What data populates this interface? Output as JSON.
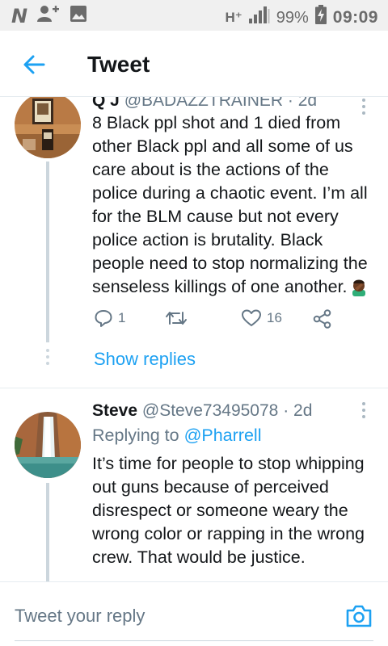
{
  "status_bar": {
    "left_letter": "N",
    "network": "H⁺",
    "battery": "99%",
    "time": "09:09"
  },
  "header": {
    "title": "Tweet"
  },
  "tweets": [
    {
      "name": "Q J",
      "handle": "@BADAZZTRAINER",
      "age": "· 2d",
      "text_lines": [
        "8 Black ppl shot and 1 died from",
        "other Black ppl and all some of us",
        "care about is the actions of the",
        "police during a chaotic event. I’m all",
        "for the BLM cause but not every",
        "police action is brutality. Black",
        "people need to stop normalizing the",
        "senseless killings of one another."
      ],
      "emoji_icon": "facepalm-emoji",
      "reply_count": "1",
      "retweet_count": "",
      "like_count": "16",
      "show_replies": "Show replies"
    },
    {
      "name": "Steve",
      "handle": "@Steve73495078",
      "age": "· 2d",
      "replying_prefix": "Replying to",
      "replying_to": "@Pharrell",
      "text_lines": [
        "It’s time for people to stop whipping",
        "out guns because of perceived",
        "disrespect or someone weary the",
        "wrong color or rapping in the wrong",
        "crew. That would be justice."
      ]
    }
  ],
  "reply_bar": {
    "placeholder": "Tweet your reply"
  },
  "colors": {
    "accent": "#1da1f2",
    "text": "#14171a",
    "secondary": "#657786",
    "thread_line": "#ccd6dd"
  }
}
